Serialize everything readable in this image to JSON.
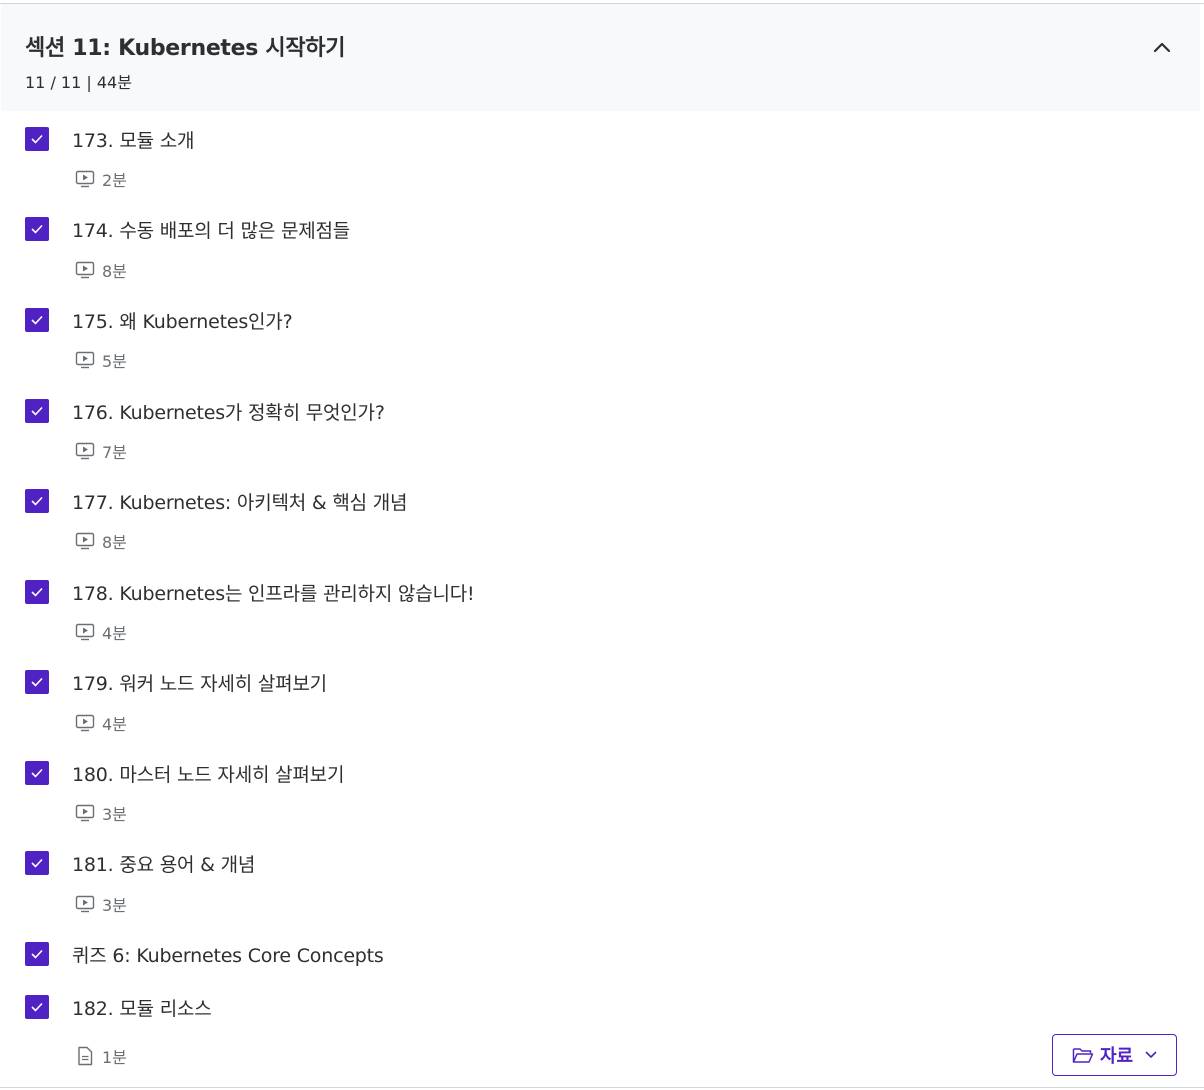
{
  "section": {
    "title": "섹션 11: Kubernetes 시작하기",
    "meta": "11 / 11 | 44분"
  },
  "lectures": [
    {
      "title": "173. 모듈 소개",
      "duration": "2분",
      "type": "video",
      "completed": true
    },
    {
      "title": "174. 수동 배포의 더 많은 문제점들",
      "duration": "8분",
      "type": "video",
      "completed": true
    },
    {
      "title": "175. 왜 Kubernetes인가?",
      "duration": "5분",
      "type": "video",
      "completed": true
    },
    {
      "title": "176. Kubernetes가 정확히 무엇인가?",
      "duration": "7분",
      "type": "video",
      "completed": true
    },
    {
      "title": "177. Kubernetes: 아키텍처 & 핵심 개념",
      "duration": "8분",
      "type": "video",
      "completed": true
    },
    {
      "title": "178. Kubernetes는 인프라를 관리하지 않습니다!",
      "duration": "4분",
      "type": "video",
      "completed": true
    },
    {
      "title": "179. 워커 노드 자세히 살펴보기",
      "duration": "4분",
      "type": "video",
      "completed": true
    },
    {
      "title": "180. 마스터 노드 자세히 살펴보기",
      "duration": "3분",
      "type": "video",
      "completed": true
    },
    {
      "title": "181. 중요 용어 & 개념",
      "duration": "3분",
      "type": "video",
      "completed": true
    },
    {
      "title": "퀴즈 6: Kubernetes Core Concepts",
      "type": "quiz",
      "completed": true
    },
    {
      "title": "182. 모듈 리소스",
      "duration": "1분",
      "type": "article",
      "completed": true
    }
  ],
  "resources_button": {
    "label": "자료",
    "icon": "folder-icon"
  },
  "colors": {
    "accent": "#5022c3",
    "header_bg": "#f7f9fa",
    "muted_text": "#6a6f73"
  }
}
